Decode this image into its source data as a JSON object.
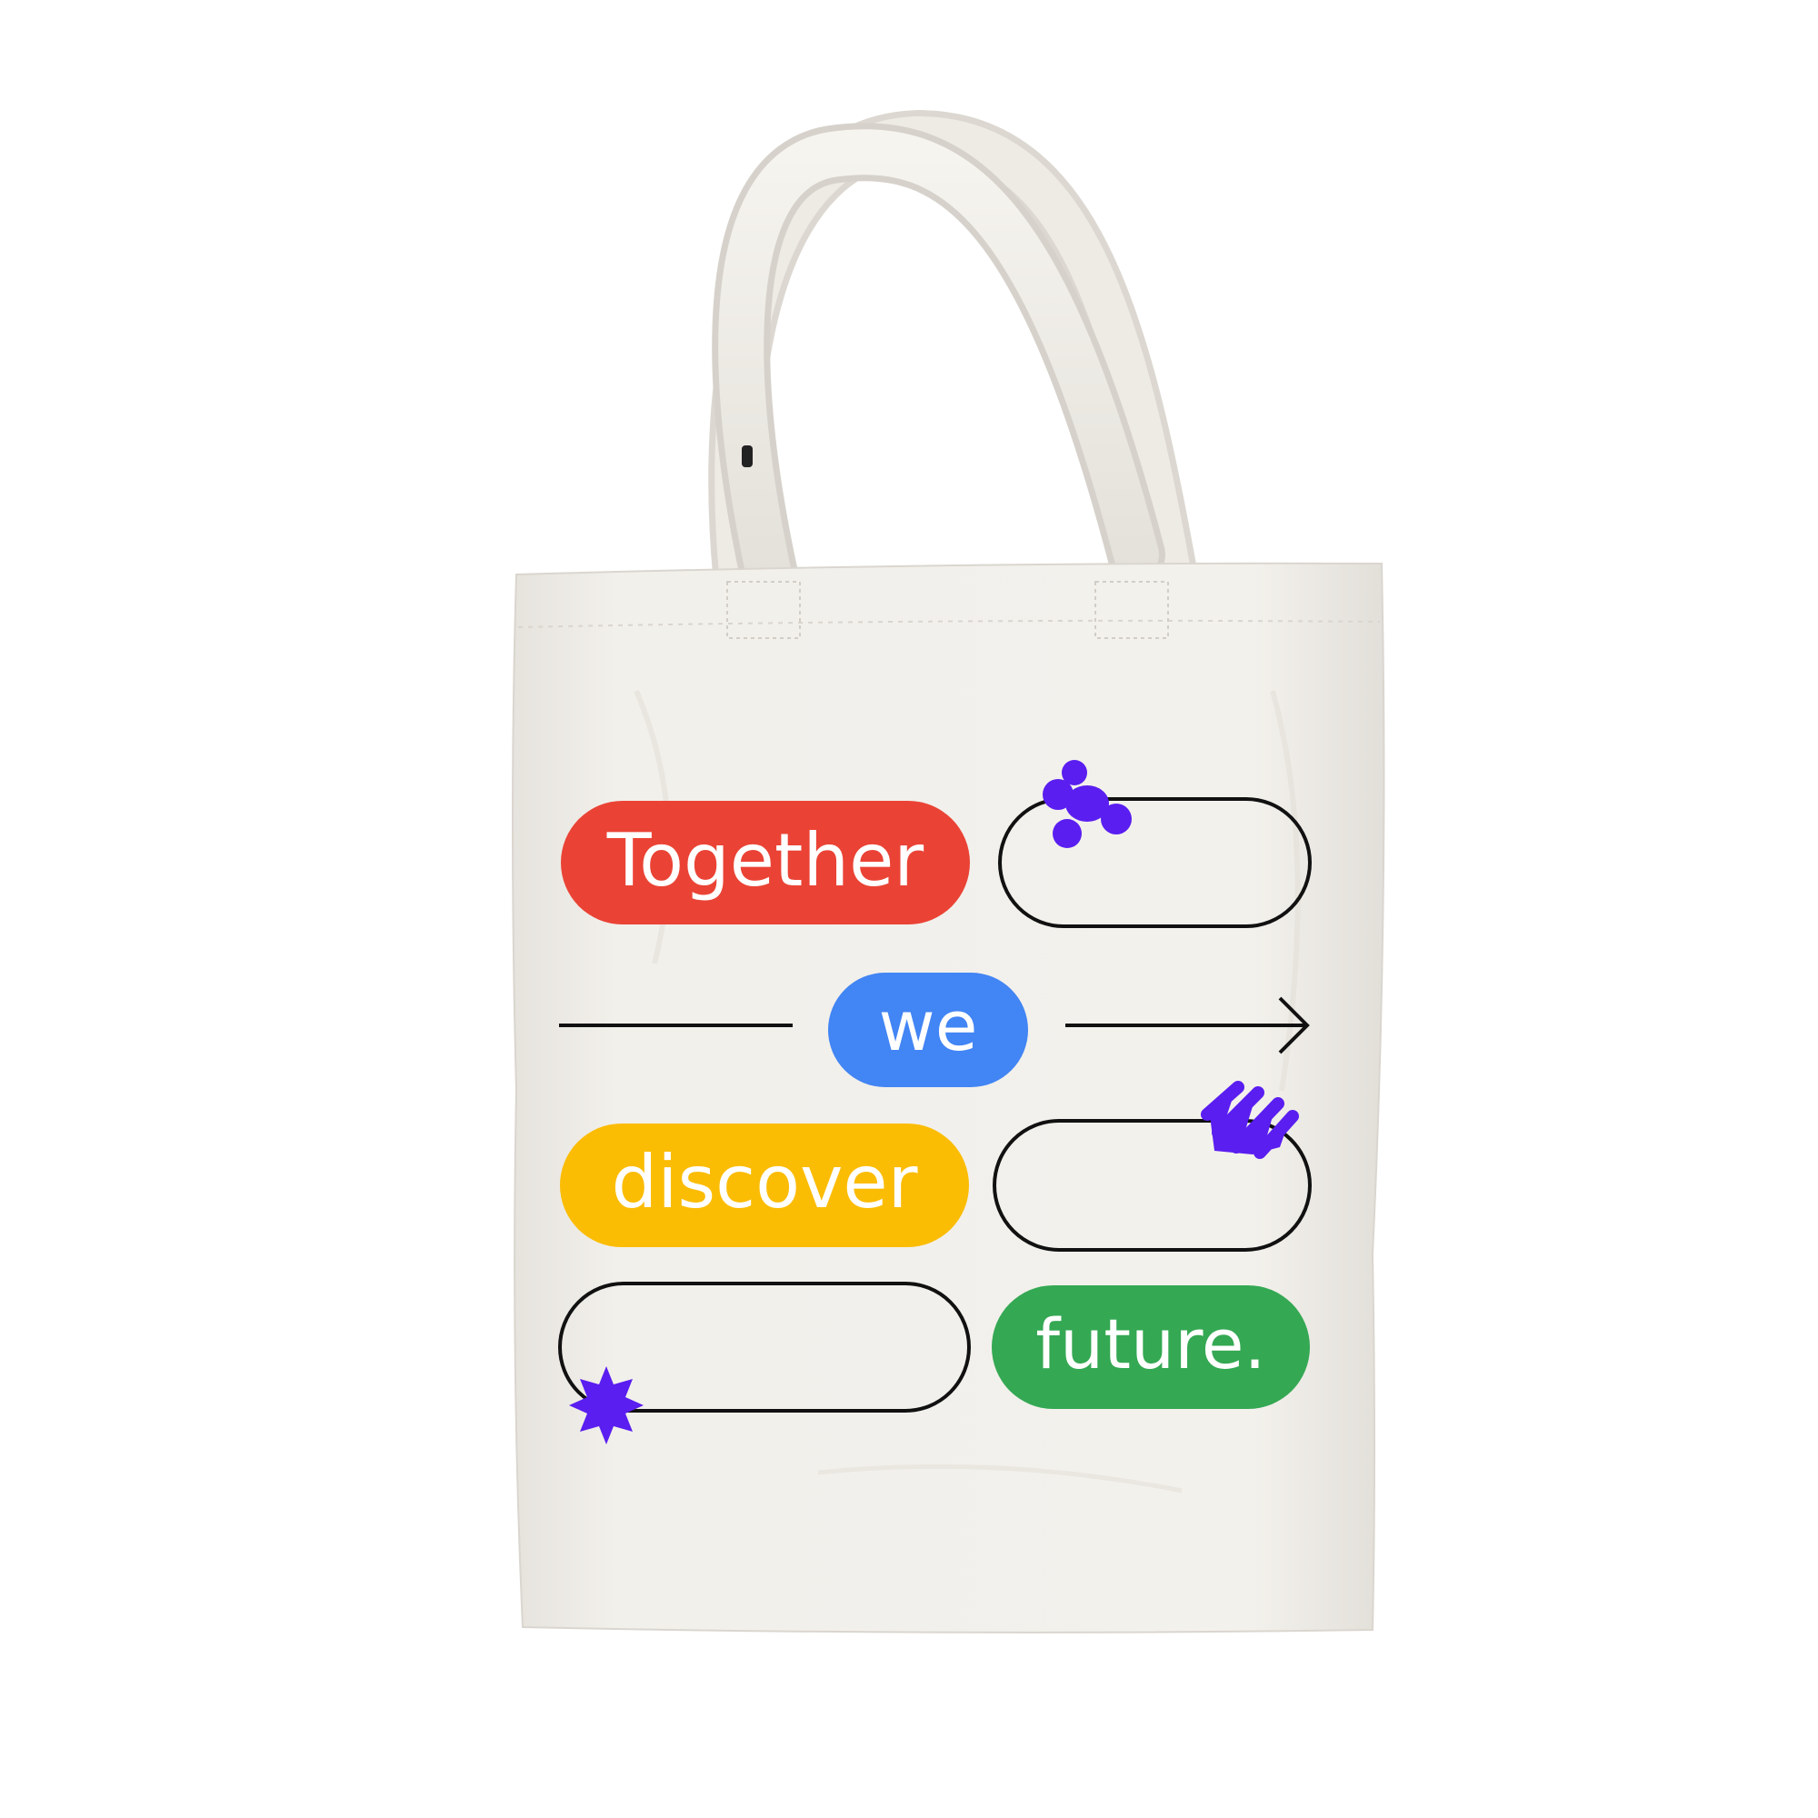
{
  "tote": {
    "words": {
      "together": "Together",
      "we": "we",
      "discover": "discover",
      "future": "future."
    },
    "colors": {
      "canvas": "#f1efea",
      "handle": "#f4f2ed",
      "red": "#ea4335",
      "blue": "#4285f4",
      "yellow": "#fbbc04",
      "green": "#34a853",
      "purple": "#5a1ef0",
      "line": "#111111",
      "text_light": "#ffffff"
    },
    "icons": [
      "flower-blob-icon",
      "scribble-icon",
      "starburst-icon",
      "arrow-right-icon"
    ]
  }
}
